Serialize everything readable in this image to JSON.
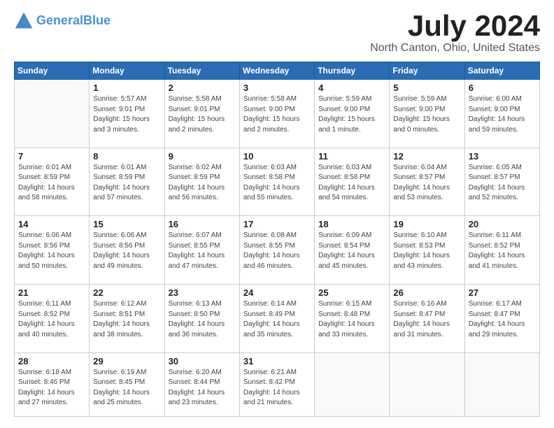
{
  "header": {
    "logo_line1": "General",
    "logo_line2": "Blue",
    "month_year": "July 2024",
    "location": "North Canton, Ohio, United States"
  },
  "days_of_week": [
    "Sunday",
    "Monday",
    "Tuesday",
    "Wednesday",
    "Thursday",
    "Friday",
    "Saturday"
  ],
  "weeks": [
    [
      {
        "day": "",
        "info": ""
      },
      {
        "day": "1",
        "info": "Sunrise: 5:57 AM\nSunset: 9:01 PM\nDaylight: 15 hours\nand 3 minutes."
      },
      {
        "day": "2",
        "info": "Sunrise: 5:58 AM\nSunset: 9:01 PM\nDaylight: 15 hours\nand 2 minutes."
      },
      {
        "day": "3",
        "info": "Sunrise: 5:58 AM\nSunset: 9:00 PM\nDaylight: 15 hours\nand 2 minutes."
      },
      {
        "day": "4",
        "info": "Sunrise: 5:59 AM\nSunset: 9:00 PM\nDaylight: 15 hours\nand 1 minute."
      },
      {
        "day": "5",
        "info": "Sunrise: 5:59 AM\nSunset: 9:00 PM\nDaylight: 15 hours\nand 0 minutes."
      },
      {
        "day": "6",
        "info": "Sunrise: 6:00 AM\nSunset: 9:00 PM\nDaylight: 14 hours\nand 59 minutes."
      }
    ],
    [
      {
        "day": "7",
        "info": "Sunrise: 6:01 AM\nSunset: 8:59 PM\nDaylight: 14 hours\nand 58 minutes."
      },
      {
        "day": "8",
        "info": "Sunrise: 6:01 AM\nSunset: 8:59 PM\nDaylight: 14 hours\nand 57 minutes."
      },
      {
        "day": "9",
        "info": "Sunrise: 6:02 AM\nSunset: 8:59 PM\nDaylight: 14 hours\nand 56 minutes."
      },
      {
        "day": "10",
        "info": "Sunrise: 6:03 AM\nSunset: 8:58 PM\nDaylight: 14 hours\nand 55 minutes."
      },
      {
        "day": "11",
        "info": "Sunrise: 6:03 AM\nSunset: 8:58 PM\nDaylight: 14 hours\nand 54 minutes."
      },
      {
        "day": "12",
        "info": "Sunrise: 6:04 AM\nSunset: 8:57 PM\nDaylight: 14 hours\nand 53 minutes."
      },
      {
        "day": "13",
        "info": "Sunrise: 6:05 AM\nSunset: 8:57 PM\nDaylight: 14 hours\nand 52 minutes."
      }
    ],
    [
      {
        "day": "14",
        "info": "Sunrise: 6:06 AM\nSunset: 8:56 PM\nDaylight: 14 hours\nand 50 minutes."
      },
      {
        "day": "15",
        "info": "Sunrise: 6:06 AM\nSunset: 8:56 PM\nDaylight: 14 hours\nand 49 minutes."
      },
      {
        "day": "16",
        "info": "Sunrise: 6:07 AM\nSunset: 8:55 PM\nDaylight: 14 hours\nand 47 minutes."
      },
      {
        "day": "17",
        "info": "Sunrise: 6:08 AM\nSunset: 8:55 PM\nDaylight: 14 hours\nand 46 minutes."
      },
      {
        "day": "18",
        "info": "Sunrise: 6:09 AM\nSunset: 8:54 PM\nDaylight: 14 hours\nand 45 minutes."
      },
      {
        "day": "19",
        "info": "Sunrise: 6:10 AM\nSunset: 8:53 PM\nDaylight: 14 hours\nand 43 minutes."
      },
      {
        "day": "20",
        "info": "Sunrise: 6:11 AM\nSunset: 8:52 PM\nDaylight: 14 hours\nand 41 minutes."
      }
    ],
    [
      {
        "day": "21",
        "info": "Sunrise: 6:11 AM\nSunset: 8:52 PM\nDaylight: 14 hours\nand 40 minutes."
      },
      {
        "day": "22",
        "info": "Sunrise: 6:12 AM\nSunset: 8:51 PM\nDaylight: 14 hours\nand 38 minutes."
      },
      {
        "day": "23",
        "info": "Sunrise: 6:13 AM\nSunset: 8:50 PM\nDaylight: 14 hours\nand 36 minutes."
      },
      {
        "day": "24",
        "info": "Sunrise: 6:14 AM\nSunset: 8:49 PM\nDaylight: 14 hours\nand 35 minutes."
      },
      {
        "day": "25",
        "info": "Sunrise: 6:15 AM\nSunset: 8:48 PM\nDaylight: 14 hours\nand 33 minutes."
      },
      {
        "day": "26",
        "info": "Sunrise: 6:16 AM\nSunset: 8:47 PM\nDaylight: 14 hours\nand 31 minutes."
      },
      {
        "day": "27",
        "info": "Sunrise: 6:17 AM\nSunset: 8:47 PM\nDaylight: 14 hours\nand 29 minutes."
      }
    ],
    [
      {
        "day": "28",
        "info": "Sunrise: 6:18 AM\nSunset: 8:46 PM\nDaylight: 14 hours\nand 27 minutes."
      },
      {
        "day": "29",
        "info": "Sunrise: 6:19 AM\nSunset: 8:45 PM\nDaylight: 14 hours\nand 25 minutes."
      },
      {
        "day": "30",
        "info": "Sunrise: 6:20 AM\nSunset: 8:44 PM\nDaylight: 14 hours\nand 23 minutes."
      },
      {
        "day": "31",
        "info": "Sunrise: 6:21 AM\nSunset: 8:42 PM\nDaylight: 14 hours\nand 21 minutes."
      },
      {
        "day": "",
        "info": ""
      },
      {
        "day": "",
        "info": ""
      },
      {
        "day": "",
        "info": ""
      }
    ]
  ]
}
